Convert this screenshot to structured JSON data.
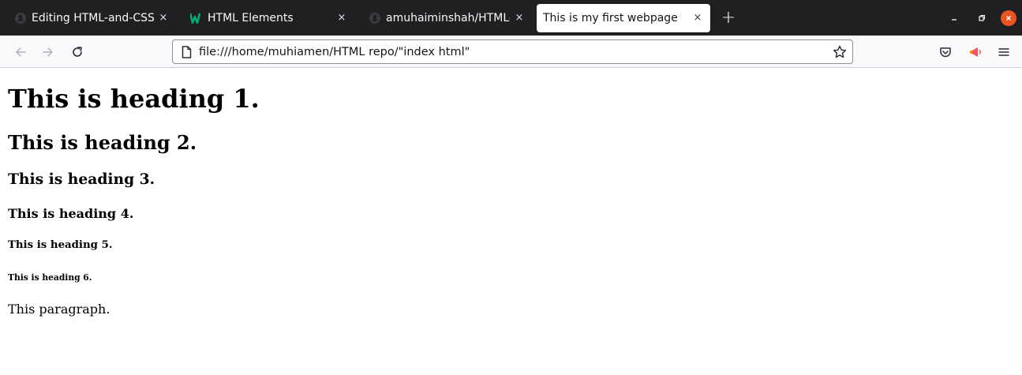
{
  "browser": {
    "tabs": [
      {
        "title": "Editing HTML-and-CSS-cr",
        "icon": "github-icon",
        "active": false
      },
      {
        "title": "HTML Elements",
        "icon": "w3schools-icon",
        "active": false
      },
      {
        "title": "amuhaiminshah/HTML-an",
        "icon": "github-icon",
        "active": false
      },
      {
        "title": "This is my first webpage",
        "icon": "",
        "active": true
      }
    ],
    "close_glyph": "×",
    "new_tab_glyph": "+",
    "url": "file:///home/muhiamen/HTML repo/\"index html\"",
    "colors": {
      "tabbar_bg": "#202023",
      "toolbar_bg": "#f9f9fb",
      "close_button": "#e95420"
    }
  },
  "page": {
    "h1": "This is heading 1.",
    "h2": "This is heading 2.",
    "h3": "This is heading 3.",
    "h4": "This is heading 4.",
    "h5": "This is heading 5.",
    "h6": "This is heading 6.",
    "paragraph": "This paragraph."
  }
}
